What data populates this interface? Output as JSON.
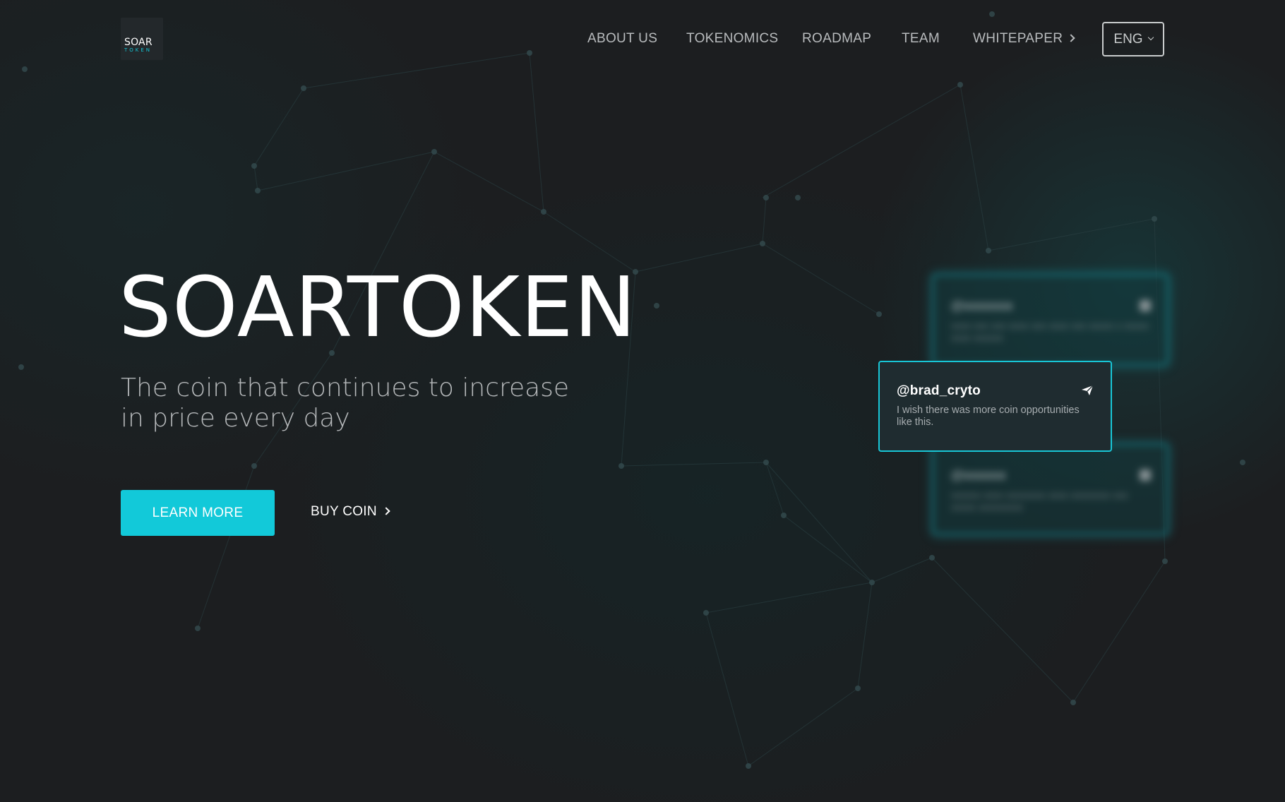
{
  "brand": {
    "logo_top": "SOAR",
    "logo_bottom": "TOKEN",
    "accent_color": "#12c9d9"
  },
  "nav": {
    "items": [
      {
        "label": "ABOUT US"
      },
      {
        "label": "TOKENOMICS"
      },
      {
        "label": "ROADMAP"
      },
      {
        "label": "TEAM"
      },
      {
        "label": "WHITEPAPER",
        "icon": "chevron-right-icon"
      }
    ],
    "language": {
      "label": "ENG",
      "icon": "chevron-down-icon"
    }
  },
  "hero": {
    "title": "SOARTOKEN",
    "subtitle": "The coin that continues to increase in price every day",
    "learn_more_label": "LEARN MORE",
    "buy_coin_label": "BUY COIN"
  },
  "testimonials": {
    "main": {
      "handle": "@brad_cryto",
      "text": "I wish there was more coin opportunities like this.",
      "icon": "send-icon"
    }
  }
}
